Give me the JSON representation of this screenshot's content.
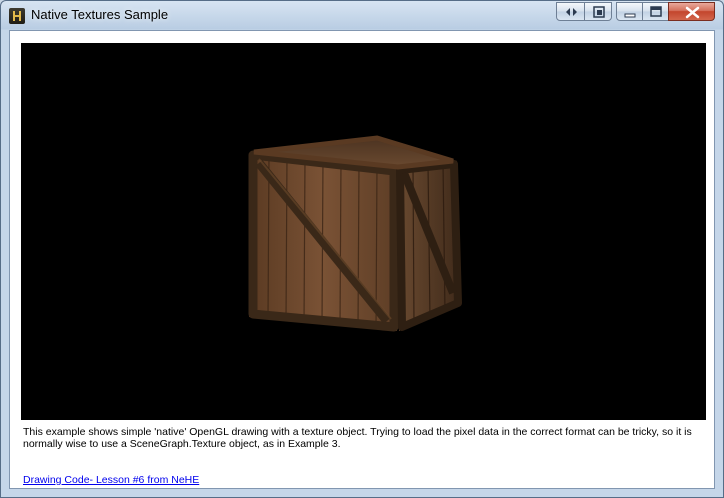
{
  "window": {
    "title": "Native Textures Sample",
    "icon": "app-icon"
  },
  "caption_buttons": {
    "extra1": "arrows-icon",
    "extra2": "window-switch-icon",
    "minimize": "minimize-icon",
    "maximize": "maximize-icon",
    "close": "close-icon"
  },
  "viewport": {
    "background": "#000000",
    "object": "textured wooden crate"
  },
  "description": "This example shows simple 'native' OpenGL drawing with a texture object.  Trying to load the pixel data in the correct format can be tricky, so it is normally wise to use a SceneGraph.Texture object, as in Example 3.",
  "link": {
    "text": "Drawing Code- Lesson #6 from NeHE"
  },
  "colors": {
    "link": "#0000ee",
    "close_button": "#c3452d",
    "frame": "#c5d6e9"
  }
}
